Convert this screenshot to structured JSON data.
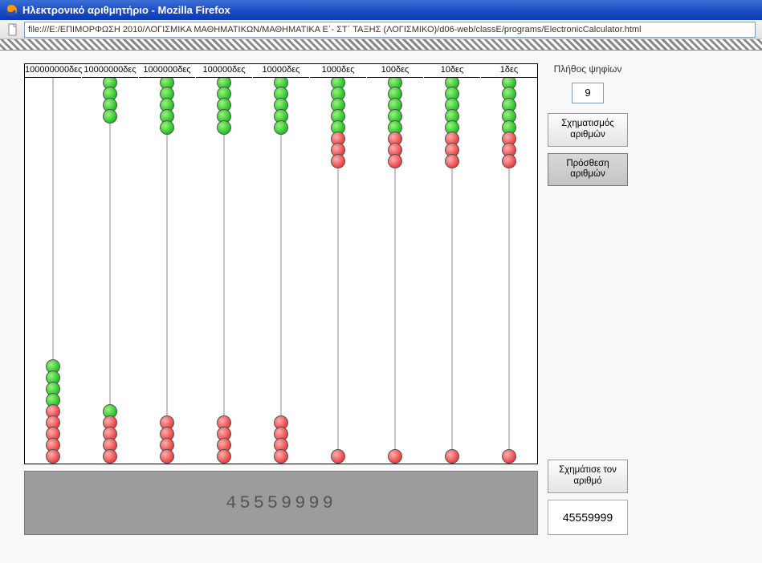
{
  "window": {
    "title": "Ηλεκτρονικό αριθμητήριο - Mozilla Firefox",
    "url": "file:///E:/ΕΠΙΜΟΡΦΩΣΗ 2010/ΛΟΓΙΣΜΙΚΑ ΜΑΘΗΜΑΤΙΚΩΝ/ΜΑΘΗΜΑΤΙΚΑ Ε΄- ΣΤ΄ ΤΑΞΗΣ (ΛΟΓΙΣΜΙΚΟ)/d06-web/classE/programs/ElectronicCalculator.html"
  },
  "abacus": {
    "rods": [
      {
        "label": "100000000δες",
        "top_green": 0,
        "top_red": 0,
        "bottom_green": 4,
        "bottom_red": 5
      },
      {
        "label": "10000000δες",
        "top_green": 4,
        "top_red": 0,
        "bottom_green": 1,
        "bottom_red": 4
      },
      {
        "label": "1000000δες",
        "top_green": 5,
        "top_red": 0,
        "bottom_green": 0,
        "bottom_red": 4
      },
      {
        "label": "100000δες",
        "top_green": 5,
        "top_red": 0,
        "bottom_green": 0,
        "bottom_red": 4
      },
      {
        "label": "10000δες",
        "top_green": 5,
        "top_red": 0,
        "bottom_green": 0,
        "bottom_red": 4
      },
      {
        "label": "1000δες",
        "top_green": 5,
        "top_red": 3,
        "bottom_green": 0,
        "bottom_red": 1
      },
      {
        "label": "100δες",
        "top_green": 5,
        "top_red": 3,
        "bottom_green": 0,
        "bottom_red": 1
      },
      {
        "label": "10δες",
        "top_green": 5,
        "top_red": 3,
        "bottom_green": 0,
        "bottom_red": 1
      },
      {
        "label": "1δες",
        "top_green": 5,
        "top_red": 3,
        "bottom_green": 0,
        "bottom_red": 1
      }
    ]
  },
  "display": {
    "number": "45559999"
  },
  "sidebar": {
    "digits_label": "Πλήθος ψηφίων",
    "digits_value": "9",
    "form_numbers": "Σχηματισμός αριθμών",
    "add_numbers": "Πρόσθεση αριθμών",
    "make_number": "Σχημάτισε τον αριθμό",
    "result": "45559999"
  },
  "colors": {
    "green": "#2fcc2f",
    "red": "#f05050",
    "titlebar": "#1f4fc5"
  }
}
